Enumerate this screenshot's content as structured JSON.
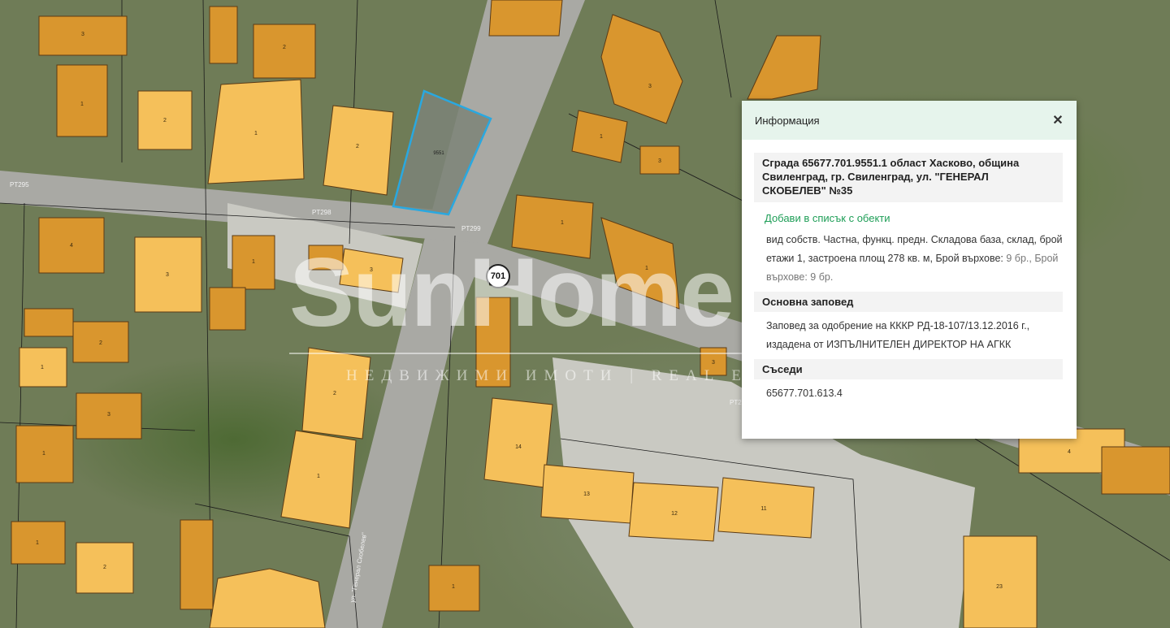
{
  "map": {
    "route_badge": "701",
    "parcel_labels": [
      "PT295",
      "PT298",
      "PT299",
      "PT2"
    ],
    "street_label": "ул. \"Генерал Скобелев\"",
    "selected_parcel": "9551"
  },
  "watermark": {
    "brand": "SunHome",
    "tagline": "НЕДВИЖИМИ ИМОТИ | REAL ESTATE"
  },
  "info_panel": {
    "header_title": "Информация",
    "close_icon": "close-icon",
    "building_title": "Сграда 65677.701.9551.1 област Хасково, община Свиленград, гр. Свиленград, ул. \"ГЕНЕРАЛ СКОБЕЛЕВ\" №35",
    "add_to_list": "Добави в списък с обекти",
    "details_main": "вид собств. Частна, функц. предн. Складова база, склад, брой етажи 1, застроена площ 278 кв. м, Брой върхове:",
    "details_muted": "9 бр., Брой върхове: 9 бр.",
    "order_heading": "Основна заповед",
    "order_text": "Заповед за одобрение на КККР РД-18-107/13.12.2016 г., издадена от ИЗПЪЛНИТЕЛЕН ДИРЕКТОР НА АГКК",
    "neighbors_heading": "Съседи",
    "neighbor_id": "65677.701.613.4"
  },
  "colors": {
    "building_fill": "#f5c05a",
    "building_dark": "#d9962e",
    "selection_outline": "#29a8e0",
    "link_green": "#1e9e57",
    "panel_header_bg": "#e6f4ec"
  }
}
